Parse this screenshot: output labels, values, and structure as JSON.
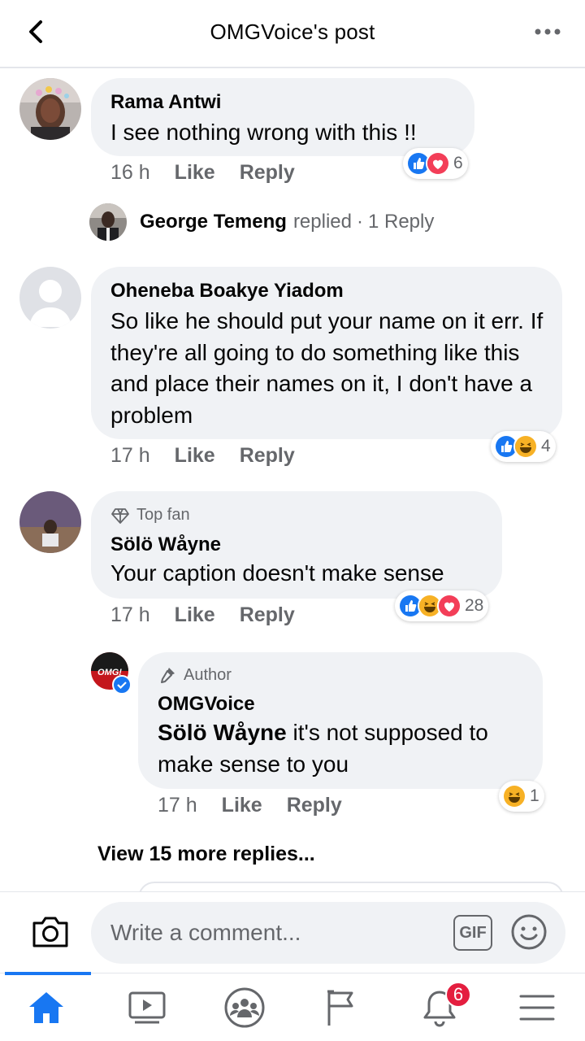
{
  "header": {
    "title": "OMGVoice's post"
  },
  "comments": [
    {
      "name": "Rama Antwi",
      "text": "I see nothing wrong with this !!",
      "time": "16 h",
      "like": "Like",
      "reply": "Reply",
      "reaction_count": "6",
      "reactions": [
        "like",
        "love"
      ]
    },
    {
      "name": "Oheneba Boakye Yiadom",
      "text": "So like he should put your name on it err. If they're all going to do something like this and place their names on it, I don't have a problem",
      "time": "17 h",
      "like": "Like",
      "reply": "Reply",
      "reaction_count": "4",
      "reactions": [
        "like",
        "haha"
      ]
    },
    {
      "badge": "Top fan",
      "name": "Sölö Wåyne",
      "text": "Your caption doesn't make sense",
      "time": "17 h",
      "like": "Like",
      "reply": "Reply",
      "reaction_count": "28",
      "reactions": [
        "like",
        "haha",
        "love"
      ]
    },
    {
      "badge": "Author",
      "name": "OMGVoice",
      "mention": "Sölö Wåyne",
      "text_after": " it's not supposed to make sense to you",
      "time": "17 h",
      "like": "Like",
      "reply": "Reply",
      "reaction_count": "1",
      "reactions": [
        "haha"
      ],
      "avatar_logo": "OMG!"
    }
  ],
  "replied_summary": {
    "name": "George Temeng",
    "action": "replied",
    "sep": "·",
    "count": "1 Reply"
  },
  "view_more": "View 15 more replies...",
  "composer": {
    "placeholder": "Write a comment...",
    "gif": "GIF"
  },
  "tabs": [
    "home-icon",
    "video-icon",
    "groups-icon",
    "pages-flag-icon",
    "notifications-bell-icon",
    "menu-icon"
  ],
  "notifications_count": "6",
  "colors": {
    "accent": "#1877f2",
    "bubble": "#f0f2f5",
    "badge": "#e41e3f"
  }
}
